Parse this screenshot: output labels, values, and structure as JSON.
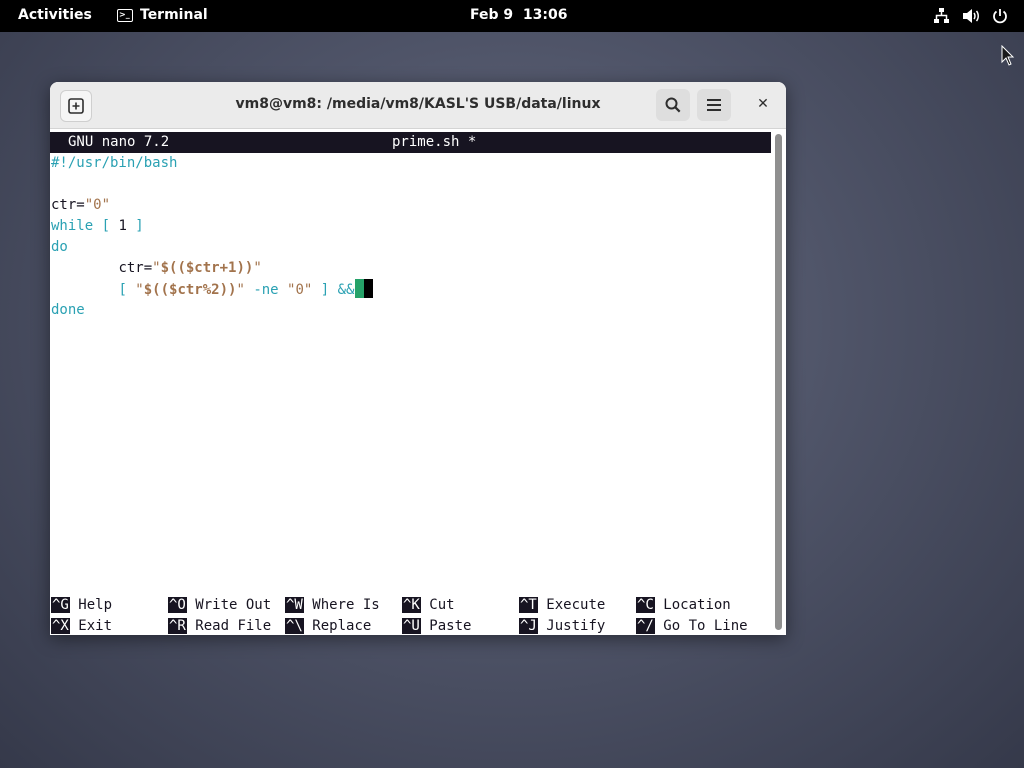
{
  "topbar": {
    "activities": "Activities",
    "app_name": "Terminal",
    "date": "Feb 9",
    "time": "13:06"
  },
  "window": {
    "title": "vm8@vm8: /media/vm8/KASL'S USB/data/linux",
    "close_symbol": "✕"
  },
  "nano": {
    "version": "GNU nano 7.2",
    "filename": "prime.sh *"
  },
  "code": {
    "line1": "#!/usr/bin/bash",
    "line3_var": "ctr=",
    "line3_val": "\"0\"",
    "line4_kw1": "while [ ",
    "line4_num": "1",
    "line4_kw2": " ]",
    "line5": "do",
    "line6_indent": "        ",
    "line6_var": "ctr=",
    "line6_q1": "\"",
    "line6_expr": "$(($ctr+1))",
    "line6_q2": "\"",
    "line7_indent": "        ",
    "line7_b1": "[ ",
    "line7_q1": "\"",
    "line7_expr": "$(($ctr%2))",
    "line7_q2": "\"",
    "line7_ne": " -ne ",
    "line7_zero": "\"0\"",
    "line7_b2": " ] &&",
    "line9": "done"
  },
  "shortcuts": {
    "row1": [
      {
        "key": "^G",
        "label": "Help"
      },
      {
        "key": "^O",
        "label": "Write Out"
      },
      {
        "key": "^W",
        "label": "Where Is"
      },
      {
        "key": "^K",
        "label": "Cut"
      },
      {
        "key": "^T",
        "label": "Execute"
      },
      {
        "key": "^C",
        "label": "Location"
      }
    ],
    "row2": [
      {
        "key": "^X",
        "label": "Exit"
      },
      {
        "key": "^R",
        "label": "Read File"
      },
      {
        "key": "^\\",
        "label": "Replace"
      },
      {
        "key": "^U",
        "label": "Paste"
      },
      {
        "key": "^J",
        "label": "Justify"
      },
      {
        "key": "^/",
        "label": "Go To Line"
      }
    ]
  },
  "colors": {
    "comment_keyword": "#2aa1b3",
    "string": "#a2734c",
    "cursor": "#26a269",
    "terminal_bg": "#ffffff",
    "terminal_fg": "#171421"
  },
  "icons": [
    "terminal-icon",
    "network-icon",
    "volume-icon",
    "power-icon",
    "new-tab-icon",
    "search-icon",
    "hamburger-menu-icon",
    "close-icon",
    "mouse-pointer-icon"
  ]
}
